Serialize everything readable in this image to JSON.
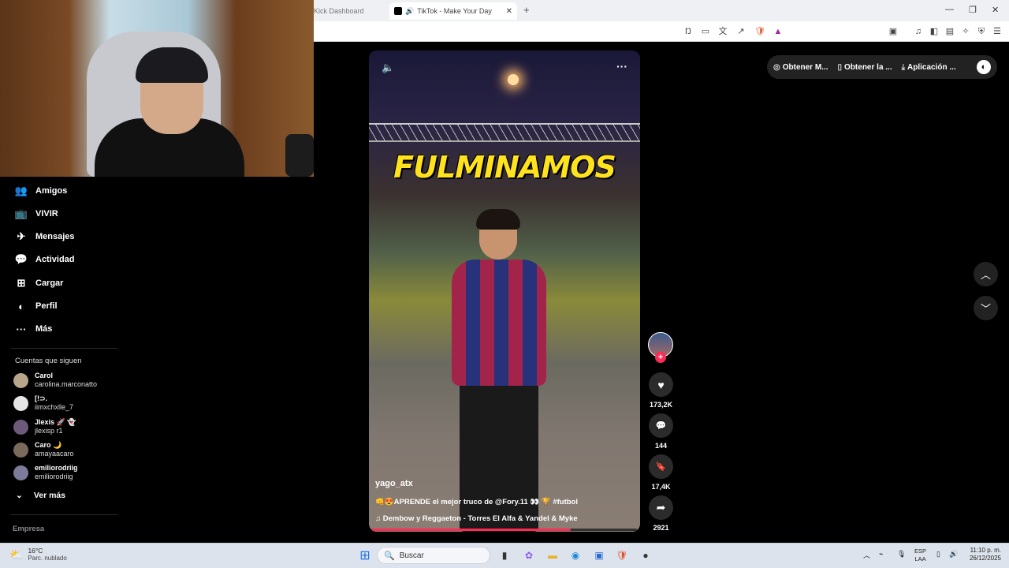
{
  "browser": {
    "tabs": [
      {
        "label": "Kick Dashboard"
      },
      {
        "label": "TikTok - Make Your Day"
      }
    ],
    "newtab_glyph": "+",
    "close_glyph": "✕",
    "speaker_glyph": "🔊"
  },
  "sidebar": {
    "items": [
      {
        "label": "Amigos",
        "icon": "friends-icon",
        "glyph": "👥"
      },
      {
        "label": "VIVIR",
        "icon": "live-icon",
        "glyph": "📺"
      },
      {
        "label": "Mensajes",
        "icon": "messages-icon",
        "glyph": "✈"
      },
      {
        "label": "Actividad",
        "icon": "activity-icon",
        "glyph": "💬"
      },
      {
        "label": "Cargar",
        "icon": "upload-icon",
        "glyph": "⊞"
      },
      {
        "label": "Perfil",
        "icon": "profile-icon",
        "glyph": "◐"
      },
      {
        "label": "Más",
        "icon": "more-icon",
        "glyph": "···"
      }
    ],
    "following_title": "Cuentas que siguen",
    "accounts": [
      {
        "name": "Carol",
        "handle": "carolina.marconatto",
        "color": "#b8a58a"
      },
      {
        "name": "[!⊃.",
        "handle": "iimxchxlle_7",
        "color": "#e6e6e6"
      },
      {
        "name": "Jlexis 🚀 👻",
        "handle": "jlexisp r1",
        "color": "#6c5a7a"
      },
      {
        "name": "Caro 🌙",
        "handle": "amayaacaro",
        "color": "#7a6a5c"
      },
      {
        "name": "emiliorodriig",
        "handle": "emiliorodriig",
        "color": "#7c7c9a"
      }
    ],
    "see_more": "Ver más",
    "see_more_icon": "⌄",
    "footer": "Empresa"
  },
  "video": {
    "headline": "FULMINAMOS",
    "mute_glyph": "🔈",
    "more_glyph": "···",
    "author": "yago_atx",
    "caption": "👊😍APRENDE el mejor truco de @Fory.11 👀 🏆 #futbol",
    "music": "♫  Dembow y Reggaeton - Torres El Alfa & Yandel & Myke",
    "progress": 0.75
  },
  "actions": {
    "likes": "173,2K",
    "comments": "144",
    "saves": "17,4K",
    "shares": "2921",
    "plus": "+",
    "like_glyph": "♥",
    "comment_glyph": "💬",
    "save_glyph": "🔖",
    "share_glyph": "➦"
  },
  "header_pill": {
    "items": [
      {
        "label": "Obtener M...",
        "glyph": "◎"
      },
      {
        "label": "Obtener la ...",
        "glyph": "▯"
      },
      {
        "label": "Aplicación ...",
        "glyph": "⤓"
      }
    ],
    "avatar": "◐"
  },
  "nav_arrows": {
    "up": "︿",
    "down": "﹀"
  },
  "taskbar": {
    "temp": "16°C",
    "weather": "Parc. nublado",
    "search": "Buscar",
    "lang1": "ESP",
    "lang2": "LAA",
    "time": "11:10 p. m.",
    "date": "26/12/2025"
  },
  "colors": {
    "accent": "#fe2c55",
    "bg": "#000000",
    "headline": "#ffe21e"
  }
}
